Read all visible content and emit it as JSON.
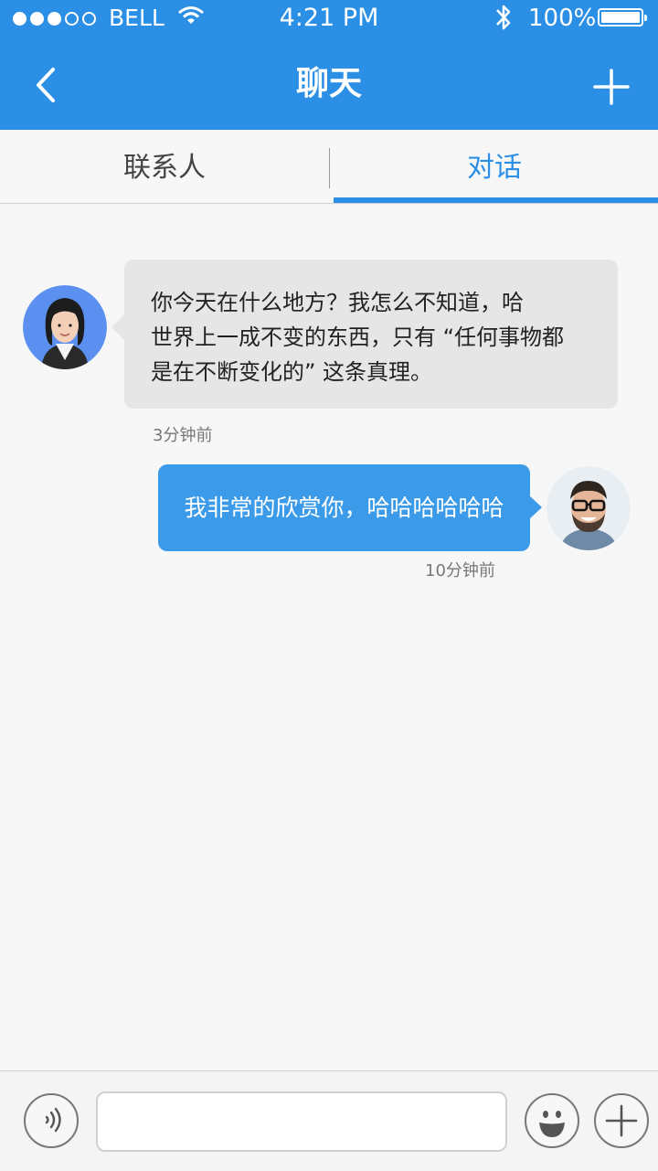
{
  "status_bar": {
    "carrier": "BELL",
    "time": "4:21 PM",
    "battery": "100%",
    "icons": [
      "signal-icon",
      "wifi-icon",
      "bluetooth-icon",
      "battery-icon"
    ]
  },
  "nav": {
    "title": "聊天",
    "back_icon": "chevron-left-icon",
    "add_icon": "plus-icon"
  },
  "tabs": [
    {
      "label": "联系人",
      "active": false
    },
    {
      "label": "对话",
      "active": true
    }
  ],
  "messages": [
    {
      "direction": "incoming",
      "lines": [
        "你今天在什么地方？我怎么不知道，哈",
        "世界上一成不变的东西，只有 “任何事物都",
        "是在不断变化的” 这条真理。"
      ],
      "time": "3分钟前"
    },
    {
      "direction": "outgoing",
      "text": "我非常的欣赏你，哈哈哈哈哈哈",
      "time": "10分钟前"
    }
  ],
  "input_bar": {
    "voice_icon": "voice-icon",
    "placeholder": "",
    "emoji_icon": "smiley-icon",
    "more_icon": "plus-icon"
  },
  "colors": {
    "primary": "#2b8fe6",
    "outgoing_bubble": "#3b9be8",
    "incoming_bubble": "#e6e6e6",
    "background": "#f7f7f7"
  }
}
